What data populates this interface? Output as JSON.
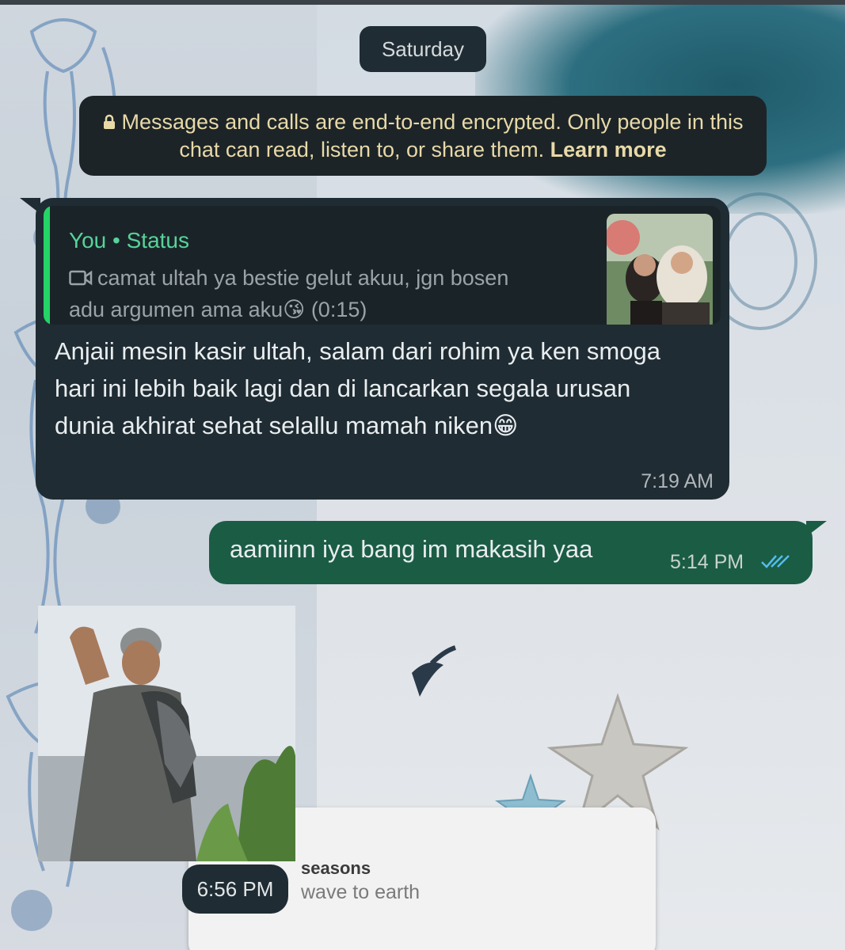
{
  "date_separator": "Saturday",
  "encryption_notice": {
    "text": "Messages and calls are end-to-end encrypted. Only people in this chat can read, listen to, or share them.",
    "link": "Learn more"
  },
  "incoming_message": {
    "quote": {
      "title": "You • Status",
      "text": "camat ultah ya bestie gelut akuu, jgn bosen adu argumen ama aku😘 (0:15)",
      "icon": "video-icon"
    },
    "text": "Anjaii mesin kasir ultah, salam dari rohim ya ken smoga hari ini lebih baik lagi dan di lancarkan segala urusan dunia akhirat sehat selallu mamah niken😁",
    "time": "7:19 AM"
  },
  "outgoing_message": {
    "text": "aamiinn iya bang im makasih yaa",
    "time": "5:14 PM",
    "status_icon": "double-check-read-icon",
    "status_color": "#53bdeb"
  },
  "sticker_message": {
    "time": "6:56 PM"
  },
  "wallpaper_song": {
    "title": "seasons",
    "artist": "wave to earth"
  },
  "colors": {
    "incoming_bubble": "#1f2c33",
    "outgoing_bubble": "#1b5c45",
    "quote_accent": "#25d366",
    "notice_text": "#e8d9a7"
  }
}
